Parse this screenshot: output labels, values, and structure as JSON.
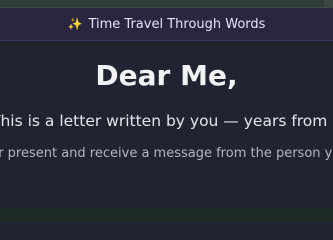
{
  "banner": {
    "icon": "sparkles-icon",
    "text": "Time Travel Through Words"
  },
  "letter": {
    "title": "Dear Me,",
    "subtitle": "This is a letter written by you — years from now.",
    "description": "our present and receive a message from the person you"
  }
}
